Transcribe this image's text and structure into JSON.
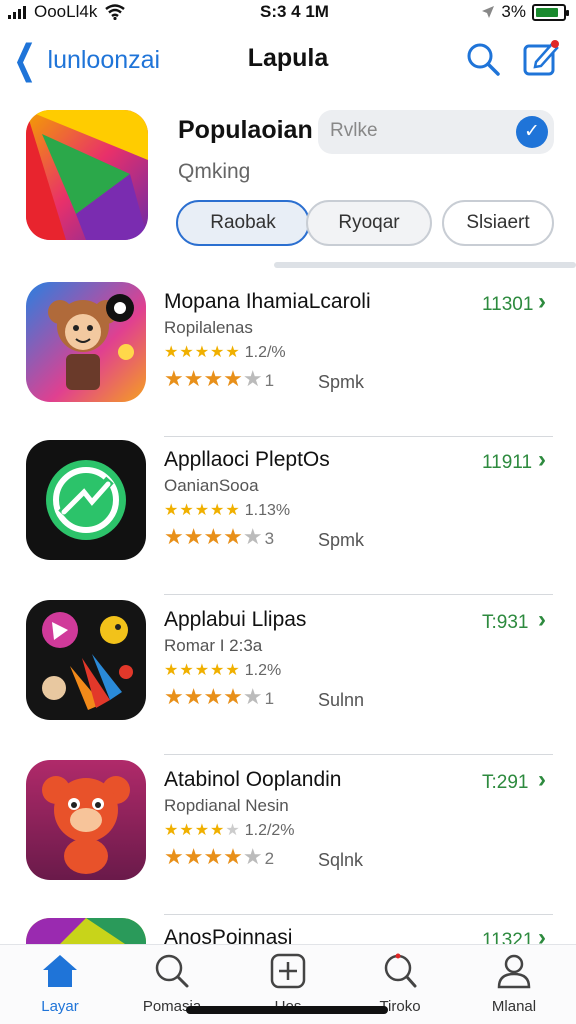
{
  "status_bar": {
    "carrier": "OooLl4k",
    "time": "S:3 4 1M",
    "battery_text": "3%"
  },
  "nav": {
    "back_label": "lunloonzai",
    "title": "Lapula"
  },
  "featured": {
    "title": "Populaoian",
    "search_value": "Rvlke",
    "subtitle": "Qmking",
    "segments": [
      "Raobak",
      "Ryoqar",
      "Slsiaert"
    ],
    "active_segment": 0
  },
  "apps": [
    {
      "name": "Mopana IhamiaLcaroli",
      "developer": "Ropilalenas",
      "small_rating": "1.2/%",
      "rating_count": "1",
      "extra": "Spmk",
      "price": "11301",
      "stars_small": 5,
      "stars_big": 4,
      "icon": "monkey-icon"
    },
    {
      "name": "Appllaoci PleptOs",
      "developer": "OanianSooa",
      "small_rating": "1.13%",
      "rating_count": "3",
      "extra": "Spmk",
      "price": "11911",
      "stars_small": 5,
      "stars_big": 4,
      "icon": "green-circle-arrows-icon"
    },
    {
      "name": "Applabui Llipas",
      "developer": "Romar I 2:3a",
      "small_rating": "1.2%",
      "rating_count": "1",
      "extra": "Sulnn",
      "price": "T:931",
      "stars_small": 5,
      "stars_big": 4,
      "icon": "party-characters-icon"
    },
    {
      "name": "Atabinol Ooplandin",
      "developer": "Ropdianal Nesin",
      "small_rating": "1.2/2%",
      "rating_count": "2",
      "extra": "Sqlnk",
      "price": "T:291",
      "stars_small": 4,
      "stars_big": 4,
      "icon": "bear-icon"
    },
    {
      "name": "AnosPoinnasi",
      "developer": "",
      "small_rating": "",
      "rating_count": "",
      "extra": "",
      "price": "11321",
      "stars_small": 0,
      "stars_big": 0,
      "icon": "colorful-app-icon"
    }
  ],
  "tabs": [
    {
      "label": "Layar",
      "icon": "home-icon"
    },
    {
      "label": "Pomasia",
      "icon": "search-icon"
    },
    {
      "label": "Uos",
      "icon": "add-icon"
    },
    {
      "label": "Tiroko",
      "icon": "search-alt-icon"
    },
    {
      "label": "Mlanal",
      "icon": "profile-icon"
    }
  ],
  "colors": {
    "accent": "#1f74d8",
    "price": "#2d8a3e",
    "star": "#f0b000"
  }
}
